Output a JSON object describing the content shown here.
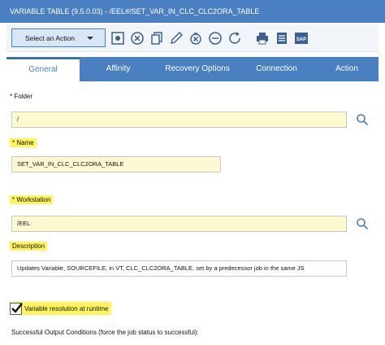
{
  "window": {
    "title": "VARIABLE TABLE (9.5.0.03) - /EEL#/SET_VAR_IN_CLC_CLC2ORA_TABLE"
  },
  "toolbar": {
    "select_action_label": "Select an Action",
    "icons": [
      "save-icon",
      "cancel-icon",
      "copy-icon",
      "edit-icon",
      "delete-icon",
      "remove-icon",
      "refresh-icon",
      "print-icon",
      "list-icon",
      "sap-icon"
    ],
    "sap_text": "SAP"
  },
  "tabs": [
    {
      "label": "General",
      "active": true
    },
    {
      "label": "Affinity",
      "active": false
    },
    {
      "label": "Recovery Options",
      "active": false
    },
    {
      "label": "Connection",
      "active": false
    },
    {
      "label": "Action",
      "active": false
    }
  ],
  "form": {
    "folder_label": "* Folder",
    "folder_value": "/",
    "name_label": "* Name",
    "name_value": "SET_VAR_IN_CLC_CLC2ORA_TABLE",
    "workstation_label": "* Workstation",
    "workstation_value": "/EEL",
    "description_label": "Description",
    "description_value": "Updates Variable, SOURCEFILE, in VT, CLC_CLC2ORA_TABLE, set by a predecessor job in the same JS",
    "variable_resolution_label": "Variable resolution at runtime",
    "variable_resolution_checked": true,
    "output_conditions_label": "Successful Output Conditions (force the job status to successful):"
  },
  "colors": {
    "brand_blue": "#4a7fc1",
    "highlight_yellow": "#fff55a",
    "field_background": "#fdfad2"
  }
}
